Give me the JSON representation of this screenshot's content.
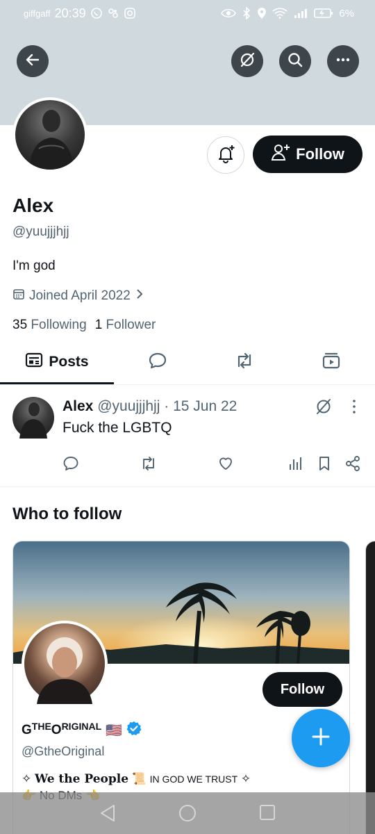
{
  "status_bar": {
    "carrier": "giffgaff",
    "time": "20:39",
    "battery": "6%"
  },
  "profile": {
    "name": "Alex",
    "handle": "@yuujjjhjj",
    "bio": "I'm god",
    "joined": "Joined April 2022",
    "following_count": "35",
    "following_label": "Following",
    "followers_count": "1",
    "followers_label": "Follower",
    "follow_label": "Follow"
  },
  "tabs": [
    {
      "label": "Posts",
      "icon": "posts-icon",
      "active": true
    },
    {
      "label": "",
      "icon": "reply-icon"
    },
    {
      "label": "",
      "icon": "repost-icon"
    },
    {
      "label": "",
      "icon": "media-icon"
    }
  ],
  "post": {
    "author": "Alex",
    "handle": "@yuujjjhjj",
    "separator": "·",
    "date": "15 Jun 22",
    "text": "Fuck the LGBTQ",
    "actions": [
      "reply-icon",
      "repost-icon",
      "like-icon",
      "views-icon",
      "bookmark-icon",
      "share-icon"
    ]
  },
  "who_to_follow": {
    "title": "Who to follow",
    "card": {
      "name_g": "G",
      "name_the": "THE",
      "name_o": "O",
      "name_rest": "RIGINAL",
      "flag": "🇺🇸",
      "verified": true,
      "handle": "@GtheOriginal",
      "follow_label": "Follow",
      "bio_line1_a": "✧",
      "bio_line1_b": "We the People",
      "bio_line1_c": "📜",
      "bio_line1_d": "IN GOD WE TRUST",
      "bio_line1_e": "✧",
      "bio_line2_a": "👉",
      "bio_line2_b": "No DMs",
      "bio_line2_c": "👈"
    }
  },
  "colors": {
    "banner": "#cfd9de",
    "accent": "#1d9bf0",
    "text": "#0f1419",
    "muted": "#536471"
  }
}
